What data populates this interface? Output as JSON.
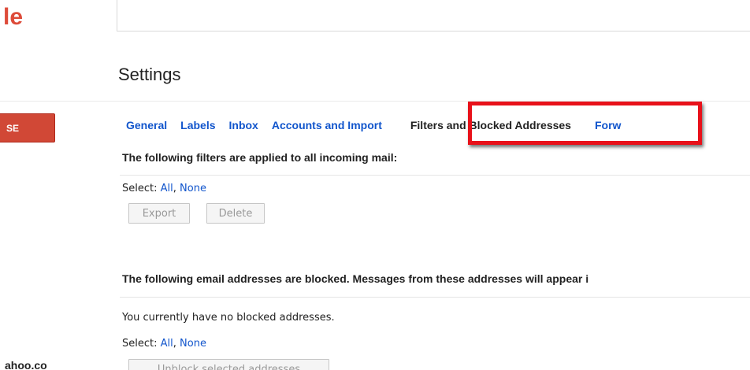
{
  "header": {
    "logo_fragment": "le"
  },
  "left_nav": {
    "compose_label": "SE",
    "account_fragment": "ahoo.co"
  },
  "settings": {
    "title": "Settings",
    "tabs": [
      {
        "label": "General"
      },
      {
        "label": "Labels"
      },
      {
        "label": "Inbox"
      },
      {
        "label": "Accounts and Import"
      },
      {
        "label": "Filters and Blocked Addresses"
      },
      {
        "label": "Forw"
      }
    ],
    "active_tab": "Filters and Blocked Addresses",
    "highlight_color": "#e8111a"
  },
  "filters_section": {
    "heading": "The following filters are applied to all incoming mail:",
    "select_prefix": "Select:",
    "select_all": "All",
    "select_sep": ",",
    "select_none": "None",
    "export_label": "Export",
    "delete_label": "Delete"
  },
  "blocked_section": {
    "heading": "The following email addresses are blocked. Messages from these addresses will appear i",
    "empty_message": "You currently have no blocked addresses.",
    "select_prefix": "Select:",
    "select_all": "All",
    "select_sep": ",",
    "select_none": "None",
    "unblock_label": "Unblock selected addresses"
  },
  "colors": {
    "link": "#1155cc",
    "compose": "#d14836",
    "logo": "#dd4b39"
  }
}
